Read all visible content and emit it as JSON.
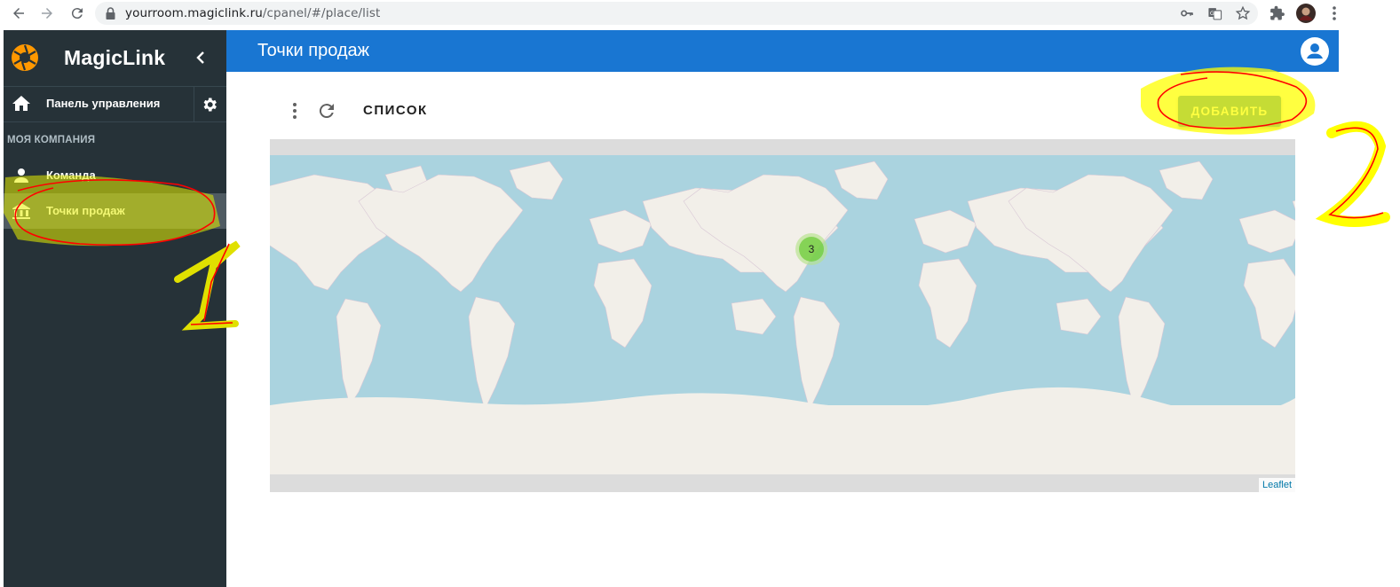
{
  "browser": {
    "url_host": "yourroom.magiclink.ru",
    "url_path": "/cpanel/#/place/list"
  },
  "sidebar": {
    "brand": "MagicLink",
    "dashboard_label": "Панель управления",
    "section_title": "МОЯ КОМПАНИЯ",
    "items": [
      {
        "label": "Команда",
        "icon": "person-icon"
      },
      {
        "label": "Точки продаж",
        "icon": "bank-icon"
      }
    ]
  },
  "header": {
    "title": "Точки продаж"
  },
  "toolbar": {
    "list_title": "СПИСОК",
    "add_label": "ДОБАВИТЬ"
  },
  "map": {
    "cluster_count": "3",
    "attribution": "Leaflet"
  },
  "annotations": {
    "marker_1": "1",
    "marker_2": "2"
  },
  "colors": {
    "primary": "#1976d2",
    "sidebar": "#263238",
    "sidebar_active": "#4f5b62",
    "highlight": "#ffff00",
    "annotation_ink": "#ff0000"
  }
}
